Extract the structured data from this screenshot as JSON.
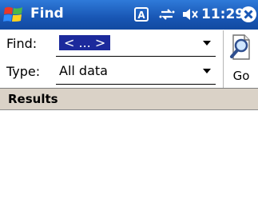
{
  "titlebar": {
    "title": "Find",
    "clock": "11:29",
    "icons": [
      "windows-start-icon",
      "input-mode-icon",
      "connectivity-icon",
      "speaker-muted-icon",
      "close-icon"
    ]
  },
  "form": {
    "find_label": "Find:",
    "find_value": "< ... >",
    "type_label": "Type:",
    "type_value": "All data",
    "go_label": "Go"
  },
  "results": {
    "header": "Results",
    "items": []
  },
  "colors": {
    "titlebar": "#1856b4",
    "selection": "#1c2a9c",
    "results_header_bg": "#dad2c7"
  }
}
